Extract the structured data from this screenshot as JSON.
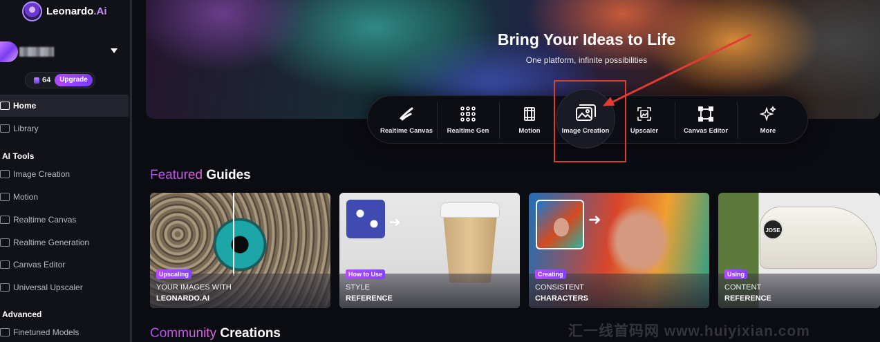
{
  "app": {
    "logo_text": "Leonardo",
    "logo_suffix": ".Ai"
  },
  "user": {
    "credits": "64",
    "upgrade_label": "Upgrade"
  },
  "sidebar": {
    "home": "Home",
    "library": "Library",
    "ai_tools_title": "AI Tools",
    "ai_tools": [
      {
        "label": "Image Creation",
        "icon": "image-icon"
      },
      {
        "label": "Motion",
        "icon": "film-icon"
      },
      {
        "label": "Realtime Canvas",
        "icon": "brush-icon"
      },
      {
        "label": "Realtime Generation",
        "icon": "grid-icon"
      },
      {
        "label": "Canvas Editor",
        "icon": "canvas-icon"
      },
      {
        "label": "Universal Upscaler",
        "icon": "upscale-icon"
      }
    ],
    "advanced_title": "Advanced",
    "advanced": [
      {
        "label": "Finetuned Models",
        "icon": "cube-icon"
      }
    ]
  },
  "hero": {
    "title": "Bring Your Ideas to Life",
    "subtitle": "One platform, infinite possibilities"
  },
  "tools": [
    {
      "label": "Realtime Canvas",
      "icon": "brush-icon"
    },
    {
      "label": "Realtime Gen",
      "icon": "grid-icon"
    },
    {
      "label": "Motion",
      "icon": "film-icon"
    },
    {
      "label": "Image Creation",
      "icon": "image-icon"
    },
    {
      "label": "Upscaler",
      "icon": "upscale-icon"
    },
    {
      "label": "Canvas Editor",
      "icon": "canvas-icon"
    },
    {
      "label": "More",
      "icon": "sparkle-icon"
    }
  ],
  "featured": {
    "accent": "Featured",
    "rest": " Guides",
    "cards": [
      {
        "tag": "Upscaling",
        "line1": "YOUR IMAGES WITH",
        "line2": "LEONARDO.AI"
      },
      {
        "tag": "How to Use",
        "line1": "STYLE",
        "line2": "REFERENCE"
      },
      {
        "tag": "Creating",
        "line1": "CONSISTENT",
        "line2": "CHARACTERS"
      },
      {
        "tag": "Using",
        "line1": "CONTENT",
        "line2": "REFERENCE"
      }
    ]
  },
  "community": {
    "accent": "Community",
    "rest": " Creations"
  },
  "shoe_badge": "JOSE",
  "watermark": "汇一线首码网 www.huiyixian.com",
  "colors": {
    "accent_purple": "#b34bff",
    "highlight_red": "#e23b32"
  }
}
